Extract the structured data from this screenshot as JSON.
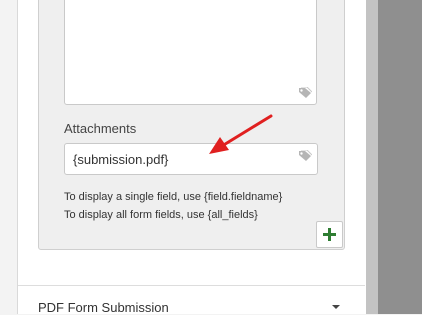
{
  "attachments": {
    "label": "Attachments",
    "value": "{submission.pdf}"
  },
  "help": {
    "single_field": "To display a single field, use {field.fieldname}",
    "all_fields": "To display all form fields, use {all_fields}"
  },
  "add_button": {
    "icon": "plus-icon",
    "color": "#2e7d32"
  },
  "next_section": {
    "title": "PDF Form Submission"
  },
  "annotation": {
    "color": "#e02020"
  }
}
